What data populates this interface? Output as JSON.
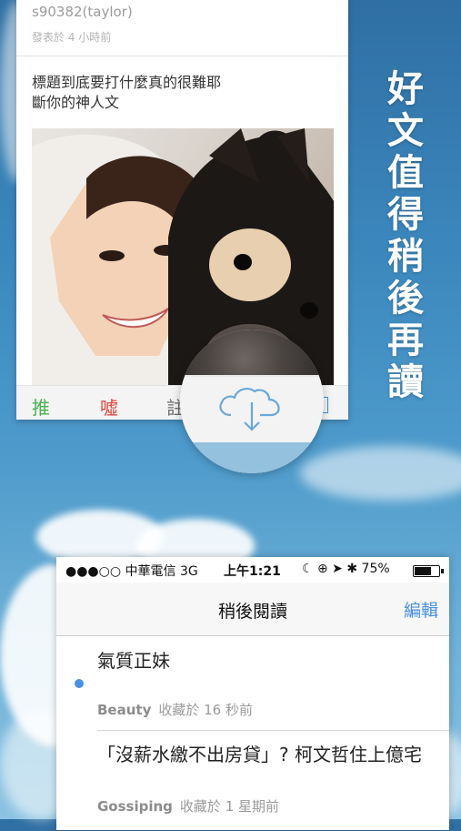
{
  "colors": {
    "push": "#4caf50",
    "boo": "#e0463c",
    "accent_blue": "#4a90e2"
  },
  "post": {
    "author": "s90382(taylor)",
    "posted": "發表於 4 小時前",
    "body_lines": [
      "標題到底要打什麼真的很難耶",
      "斷你的神人文"
    ],
    "actions": {
      "push": "推",
      "boo": "噓",
      "comment": "註"
    },
    "photo_icon": "selfie-with-dog-photo"
  },
  "magnifier": {
    "icon": "cloud-download-icon"
  },
  "tagline": "好文值得稍後再讀",
  "phone": {
    "status": {
      "signal": "●●●○○ 中華電信  3G",
      "time": "上午1:21",
      "right": "☾ ⊕ ➤ ✱ 75%",
      "battery_level": 0.75
    },
    "nav": {
      "title": "稍後閱讀",
      "edit": "編輯"
    },
    "items": [
      {
        "title": "氣質正妹",
        "board": "Beauty",
        "saved": "收藏於 16 秒前",
        "unread": true
      },
      {
        "title": "「沒薪水繳不出房貸」? 柯文哲住上億宅",
        "board": "Gossiping",
        "saved": "收藏於 1 星期前",
        "unread": false
      }
    ]
  }
}
